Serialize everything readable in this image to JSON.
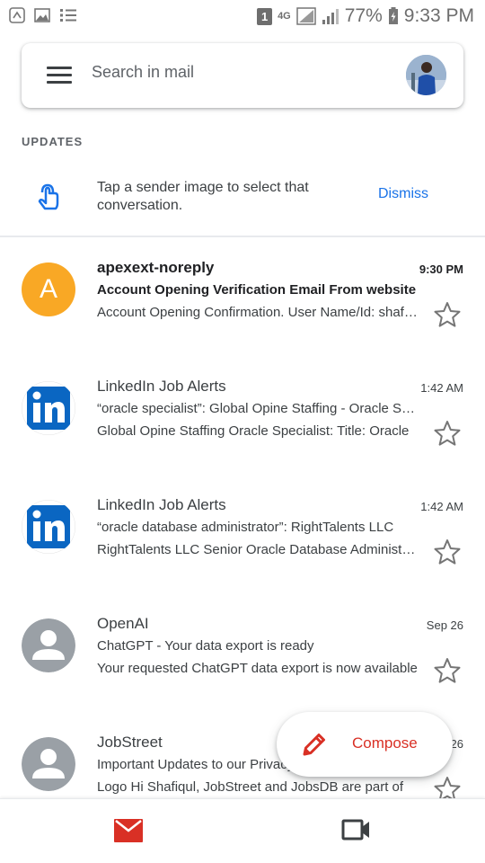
{
  "status_bar": {
    "sim_slot": "1",
    "network_type": "4G",
    "battery_percent": "77%",
    "time": "9:33 PM"
  },
  "search": {
    "placeholder": "Search in mail"
  },
  "section_label": "UPDATES",
  "tip": {
    "text": "Tap a sender image to select that conversation.",
    "dismiss_label": "Dismiss"
  },
  "mails": [
    {
      "avatar_letter": "A",
      "avatar_color": "#f9a825",
      "sender": "apexext-noreply",
      "time": "9:30 PM",
      "subject": "Account Opening Verification Email From website",
      "snippet": "Account Opening Confirmation. User Name/Id: shafiqul",
      "unread": true
    },
    {
      "avatar_icon": "linkedin-logo",
      "sender": "LinkedIn Job Alerts",
      "time": "1:42 AM",
      "subject": "“oracle specialist”: Global Opine Staffing - Oracle Specialist",
      "snippet": "Global Opine Staffing Oracle Specialist: Title: Oracle",
      "unread": false
    },
    {
      "avatar_icon": "linkedin-logo",
      "sender": "LinkedIn Job Alerts",
      "time": "1:42 AM",
      "subject": "“oracle database administrator”: RightTalents LLC",
      "snippet": "RightTalents LLC Senior Oracle Database Administrator",
      "unread": false
    },
    {
      "avatar_icon": "person-silhouette",
      "sender": "OpenAI",
      "time": "Sep 26",
      "subject": "ChatGPT - Your data export is ready",
      "snippet": "Your requested ChatGPT data export is now available",
      "unread": false
    },
    {
      "avatar_icon": "person-silhouette",
      "sender": "JobStreet",
      "time": "Sep 26",
      "subject": "Important Updates to our Privacy Policy",
      "snippet": "Logo Hi Shafiqul, JobStreet and JobsDB are part of",
      "unread": false
    }
  ],
  "compose": {
    "label": "Compose"
  },
  "colors": {
    "accent_blue": "#1a73e8",
    "compose_red": "#d93025",
    "linkedin_blue": "#0a66c2",
    "avatar_gray": "#9aa0a6"
  },
  "bottom_nav": {
    "mail_icon": "mail-icon",
    "meet_icon": "video-icon"
  }
}
